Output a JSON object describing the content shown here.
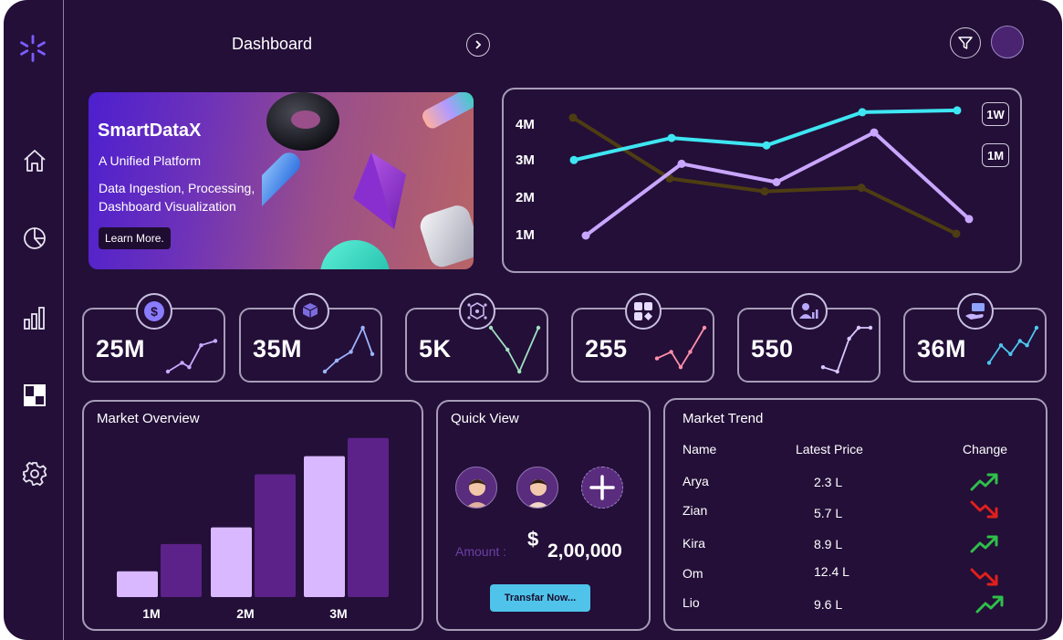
{
  "header": {
    "title": "Dashboard"
  },
  "banner": {
    "brand": "SmartDataX",
    "tagline": "A Unified Platform",
    "desc_line1": "Data Ingestion, Processing,",
    "desc_line2": "Dashboard Visualization",
    "cta": "Learn More."
  },
  "line_chart": {
    "y_ticks": [
      "4M",
      "3M",
      "2M",
      "1M"
    ],
    "range_buttons": [
      "1W",
      "1M"
    ]
  },
  "stats": [
    {
      "value": "25M",
      "icon": "dollar-icon",
      "spark_color": "#c9a9ff"
    },
    {
      "value": "35M",
      "icon": "cubes-icon",
      "spark_color": "#9db4ff"
    },
    {
      "value": "5K",
      "icon": "network-box-icon",
      "spark_color": "#9fe0c0"
    },
    {
      "value": "255",
      "icon": "apps-icon",
      "spark_color": "#ff8fab"
    },
    {
      "value": "550",
      "icon": "user-chart-icon",
      "spark_color": "#d8c8ff"
    },
    {
      "value": "36M",
      "icon": "hand-money-icon",
      "spark_color": "#4ec6f0"
    }
  ],
  "market_overview": {
    "title": "Market Overview"
  },
  "quick_view": {
    "title": "Quick View",
    "amount_label": "Amount :",
    "currency": "$",
    "amount": "2,00,000",
    "button": "Transfar Now..."
  },
  "market_trend": {
    "title": "Market Trend",
    "headers": {
      "name": "Name",
      "price": "Latest Price",
      "change": "Change"
    },
    "rows": [
      {
        "name": "Arya",
        "price": "2.3 L",
        "trend": "up"
      },
      {
        "name": "Zian",
        "price": "5.7 L",
        "trend": "down"
      },
      {
        "name": "Kira",
        "price": "8.9 L",
        "trend": "up"
      },
      {
        "name": "Om",
        "price": "12.4 L",
        "trend": "down"
      },
      {
        "name": "Lio",
        "price": "9.6 L",
        "trend": "up"
      }
    ]
  },
  "colors": {
    "bg": "#230f38",
    "accent_cyan": "#3ee6f2",
    "accent_lavender": "#c9a6ff",
    "accent_olive": "#4e3d12",
    "up": "#2fbf4a",
    "down": "#e0201c"
  },
  "chart_data": [
    {
      "type": "line",
      "title": "",
      "x": [
        1,
        2,
        3,
        4,
        5,
        6
      ],
      "y_ticks": [
        "1M",
        "2M",
        "3M",
        "4M"
      ],
      "series": [
        {
          "values": [
            3.0,
            3.6,
            3.4,
            4.3,
            4.35
          ]
        },
        {
          "values": [
            0.95,
            2.9,
            2.4,
            3.75,
            1.4
          ]
        },
        {
          "values": [
            4.15,
            2.5,
            2.15,
            2.25,
            1.0
          ]
        }
      ]
    },
    {
      "type": "bar",
      "title": "Market Overview",
      "categories": [
        "1M",
        "2M",
        "3M"
      ],
      "series": [
        {
          "values": [
            17,
            46,
            93
          ]
        },
        {
          "values": [
            35,
            81,
            105
          ]
        }
      ]
    }
  ]
}
